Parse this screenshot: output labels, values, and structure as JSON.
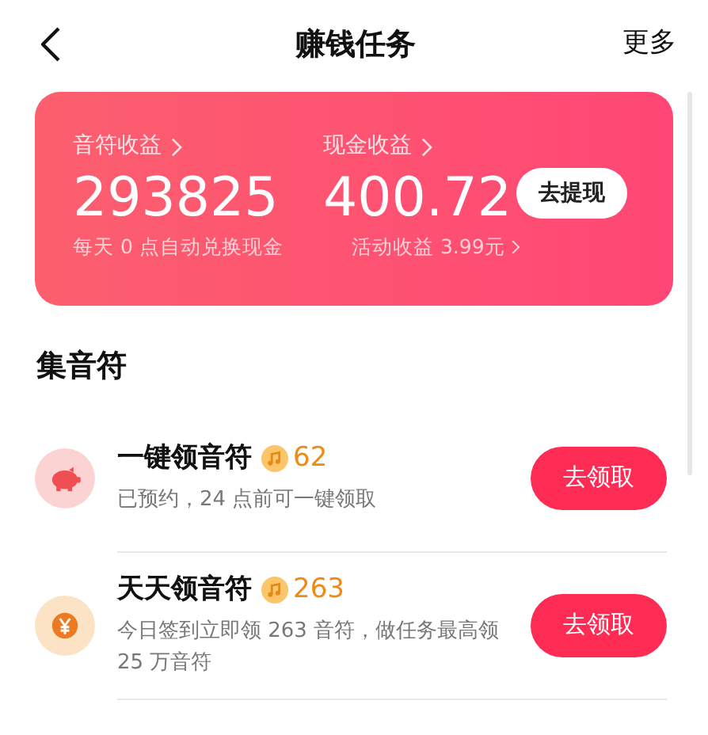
{
  "header": {
    "title": "赚钱任务",
    "more": "更多"
  },
  "earnings": {
    "notes": {
      "label": "音符收益",
      "value": "293825",
      "note": "每天 0 点自动兑换现金"
    },
    "cash": {
      "label": "现金收益",
      "value": "400.72",
      "note": "活动收益 3.99元"
    },
    "withdraw_button": "去提现"
  },
  "section_title": "集音符",
  "tasks": [
    {
      "kind": "piggy",
      "title": "一键领音符",
      "reward": "62",
      "description": "已预约，24 点前可一键领取",
      "button": "去领取"
    },
    {
      "kind": "yen",
      "title": "天天领音符",
      "reward": "263",
      "description": "今日签到立即领 263 音符，做任务最高领 25 万音符",
      "button": "去领取"
    }
  ]
}
